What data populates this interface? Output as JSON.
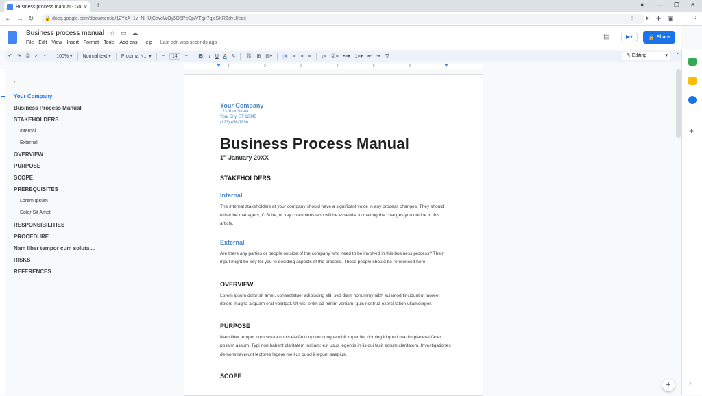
{
  "browser": {
    "tab_title": "Business process manual - Goog",
    "tab_close": "✕",
    "new_tab": "+",
    "url": "docs.google.com/document/d/12YzA_1v_NHUjCtwcWOy5D5PcCp/VTgir7gjcSXRZdyU/edit"
  },
  "doc": {
    "title": "Business process manual",
    "menu": [
      "File",
      "Edit",
      "View",
      "Insert",
      "Format",
      "Tools",
      "Add-ons",
      "Help"
    ],
    "last_edit": "Last edit was seconds ago",
    "share_label": "Share"
  },
  "toolbar": {
    "zoom": "100%",
    "style": "Normal text",
    "font": "Proxima N...",
    "font_size": "14",
    "mode": "Editing"
  },
  "ruler": [
    "1",
    "2",
    "3",
    "4",
    "5",
    "6",
    "7"
  ],
  "outline": [
    {
      "label": "Your Company",
      "level": 1,
      "current": true
    },
    {
      "label": "Business Process Manual",
      "level": 1
    },
    {
      "label": "STAKEHOLDERS",
      "level": 1
    },
    {
      "label": "Internal",
      "level": 2
    },
    {
      "label": "External",
      "level": 2
    },
    {
      "label": "OVERVIEW",
      "level": 1
    },
    {
      "label": "PURPOSE",
      "level": 1
    },
    {
      "label": "SCOPE",
      "level": 1
    },
    {
      "label": "PREREQUISITES",
      "level": 1
    },
    {
      "label": "Lorem Ipsum",
      "level": 2
    },
    {
      "label": "Dolor Sit Amet",
      "level": 2
    },
    {
      "label": "RESPONSIBILITIES",
      "level": 1
    },
    {
      "label": "PROCEDURE",
      "level": 1
    },
    {
      "label": "Nam liber tempor cum soluta ...",
      "level": 1
    },
    {
      "label": "RISKS",
      "level": 1
    },
    {
      "label": "REFERENCES",
      "level": 1
    }
  ],
  "page": {
    "company": "Your Company",
    "address1": "123 Your Street",
    "address2": "Your City, ST 12345",
    "phone": "(123) 456-7890",
    "main_title": "Business Process Manual",
    "date_day": "1",
    "date_sup": "st",
    "date_rest": " January 20XX",
    "stakeholders": "STAKEHOLDERS",
    "internal": "Internal",
    "internal_text": "The internal stakeholders at your company should have a significant voice in any process changes. They should either be managers, C Suite, or key champions who will be essential to making the changes you outline in this article.",
    "external": "External",
    "external_text_1": "Are there any parties or people outside of the company who need to be involved in this business process? Their input might be key for you to ",
    "external_text_link": "deciding",
    "external_text_2": " aspects of the process. Those people should be referenced here.",
    "overview": "OVERVIEW",
    "overview_text": "Lorem ipsum dolor sit amet, consectetuer adipiscing elit, sed diam nonummy nibh euismod tincidunt ut laoreet dolore magna aliquam erat volutpat. Ut wisi enim ad minim veniam, quis nostrud exerci tation ullamcorper.",
    "purpose": "PURPOSE",
    "purpose_text": "Nam liber tempor cum soluta nobis eleifend option congue nihil imperdiet doming id quod mazim placerat facer possim assum. Typi non habent claritatem insitam; est usus legentis in iis qui facit eorum claritatem. Investigationes demonstraverunt lectores legere me lius quod ii legunt saepius.",
    "scope": "SCOPE"
  }
}
